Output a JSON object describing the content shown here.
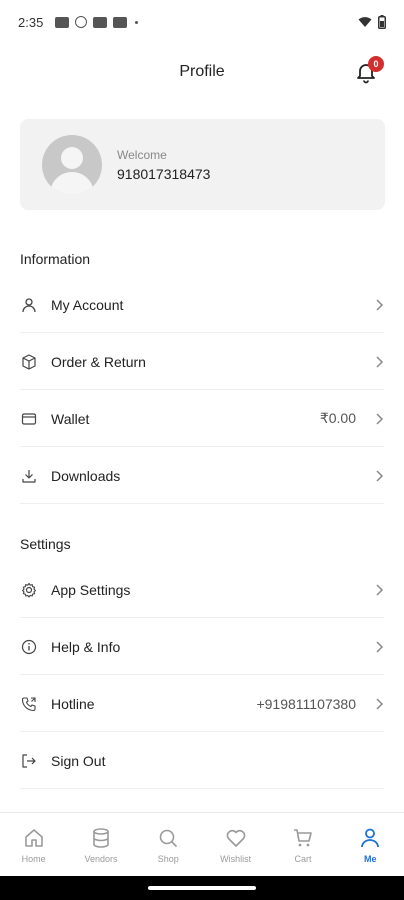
{
  "status_bar": {
    "time": "2:35",
    "icons": [
      "gmail-icon",
      "circle-icon",
      "youtube-icon",
      "youtube-icon",
      "dot-icon"
    ],
    "right_icons": [
      "wifi-icon",
      "battery-icon"
    ]
  },
  "header": {
    "title": "Profile",
    "notification_count": "0"
  },
  "profile": {
    "welcome": "Welcome",
    "phone": "918017318473"
  },
  "sections": {
    "information": "Information",
    "settings": "Settings"
  },
  "information_items": [
    {
      "label": "My Account",
      "icon": "user-icon"
    },
    {
      "label": "Order & Return",
      "icon": "box-icon"
    },
    {
      "label": "Wallet",
      "icon": "wallet-icon",
      "value": "₹0.00"
    },
    {
      "label": "Downloads",
      "icon": "download-icon"
    }
  ],
  "settings_items": [
    {
      "label": "App Settings",
      "icon": "gear-icon"
    },
    {
      "label": "Help & Info",
      "icon": "info-icon"
    },
    {
      "label": "Hotline",
      "icon": "phone-icon",
      "value": "+919811107380"
    },
    {
      "label": "Sign Out",
      "icon": "sign-out-icon"
    }
  ],
  "bottom_nav": [
    {
      "label": "Home",
      "icon": "home-icon"
    },
    {
      "label": "Vendors",
      "icon": "database-icon"
    },
    {
      "label": "Shop",
      "icon": "search-icon"
    },
    {
      "label": "Wishlist",
      "icon": "heart-icon"
    },
    {
      "label": "Cart",
      "icon": "cart-icon"
    },
    {
      "label": "Me",
      "icon": "person-icon",
      "active": true
    }
  ],
  "colors": {
    "accent": "#1f6fd6",
    "badge": "#d32f2f",
    "card_bg": "#f2f2f2"
  }
}
